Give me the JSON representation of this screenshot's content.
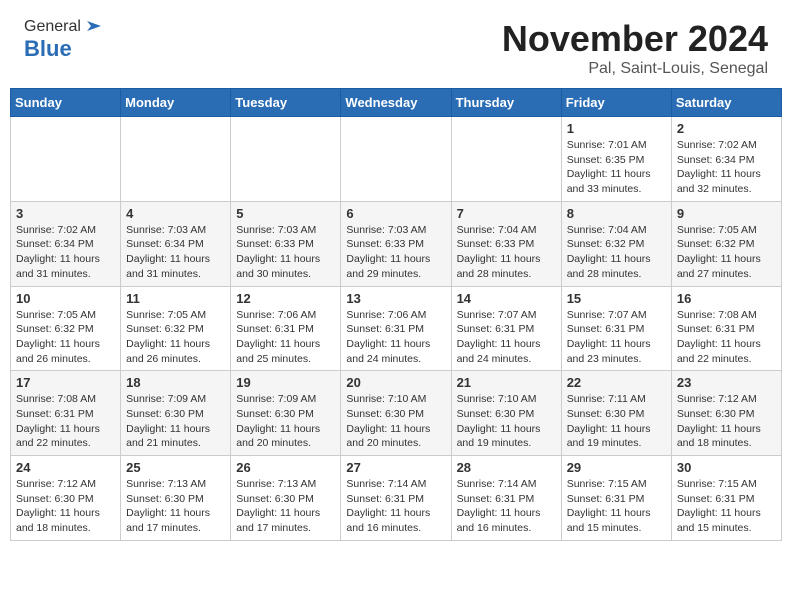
{
  "header": {
    "logo_general": "General",
    "logo_blue": "Blue",
    "month": "November 2024",
    "location": "Pal, Saint-Louis, Senegal"
  },
  "weekdays": [
    "Sunday",
    "Monday",
    "Tuesday",
    "Wednesday",
    "Thursday",
    "Friday",
    "Saturday"
  ],
  "weeks": [
    [
      {
        "day": "",
        "info": ""
      },
      {
        "day": "",
        "info": ""
      },
      {
        "day": "",
        "info": ""
      },
      {
        "day": "",
        "info": ""
      },
      {
        "day": "",
        "info": ""
      },
      {
        "day": "1",
        "info": "Sunrise: 7:01 AM\nSunset: 6:35 PM\nDaylight: 11 hours and 33 minutes."
      },
      {
        "day": "2",
        "info": "Sunrise: 7:02 AM\nSunset: 6:34 PM\nDaylight: 11 hours and 32 minutes."
      }
    ],
    [
      {
        "day": "3",
        "info": "Sunrise: 7:02 AM\nSunset: 6:34 PM\nDaylight: 11 hours and 31 minutes."
      },
      {
        "day": "4",
        "info": "Sunrise: 7:03 AM\nSunset: 6:34 PM\nDaylight: 11 hours and 31 minutes."
      },
      {
        "day": "5",
        "info": "Sunrise: 7:03 AM\nSunset: 6:33 PM\nDaylight: 11 hours and 30 minutes."
      },
      {
        "day": "6",
        "info": "Sunrise: 7:03 AM\nSunset: 6:33 PM\nDaylight: 11 hours and 29 minutes."
      },
      {
        "day": "7",
        "info": "Sunrise: 7:04 AM\nSunset: 6:33 PM\nDaylight: 11 hours and 28 minutes."
      },
      {
        "day": "8",
        "info": "Sunrise: 7:04 AM\nSunset: 6:32 PM\nDaylight: 11 hours and 28 minutes."
      },
      {
        "day": "9",
        "info": "Sunrise: 7:05 AM\nSunset: 6:32 PM\nDaylight: 11 hours and 27 minutes."
      }
    ],
    [
      {
        "day": "10",
        "info": "Sunrise: 7:05 AM\nSunset: 6:32 PM\nDaylight: 11 hours and 26 minutes."
      },
      {
        "day": "11",
        "info": "Sunrise: 7:05 AM\nSunset: 6:32 PM\nDaylight: 11 hours and 26 minutes."
      },
      {
        "day": "12",
        "info": "Sunrise: 7:06 AM\nSunset: 6:31 PM\nDaylight: 11 hours and 25 minutes."
      },
      {
        "day": "13",
        "info": "Sunrise: 7:06 AM\nSunset: 6:31 PM\nDaylight: 11 hours and 24 minutes."
      },
      {
        "day": "14",
        "info": "Sunrise: 7:07 AM\nSunset: 6:31 PM\nDaylight: 11 hours and 24 minutes."
      },
      {
        "day": "15",
        "info": "Sunrise: 7:07 AM\nSunset: 6:31 PM\nDaylight: 11 hours and 23 minutes."
      },
      {
        "day": "16",
        "info": "Sunrise: 7:08 AM\nSunset: 6:31 PM\nDaylight: 11 hours and 22 minutes."
      }
    ],
    [
      {
        "day": "17",
        "info": "Sunrise: 7:08 AM\nSunset: 6:31 PM\nDaylight: 11 hours and 22 minutes."
      },
      {
        "day": "18",
        "info": "Sunrise: 7:09 AM\nSunset: 6:30 PM\nDaylight: 11 hours and 21 minutes."
      },
      {
        "day": "19",
        "info": "Sunrise: 7:09 AM\nSunset: 6:30 PM\nDaylight: 11 hours and 20 minutes."
      },
      {
        "day": "20",
        "info": "Sunrise: 7:10 AM\nSunset: 6:30 PM\nDaylight: 11 hours and 20 minutes."
      },
      {
        "day": "21",
        "info": "Sunrise: 7:10 AM\nSunset: 6:30 PM\nDaylight: 11 hours and 19 minutes."
      },
      {
        "day": "22",
        "info": "Sunrise: 7:11 AM\nSunset: 6:30 PM\nDaylight: 11 hours and 19 minutes."
      },
      {
        "day": "23",
        "info": "Sunrise: 7:12 AM\nSunset: 6:30 PM\nDaylight: 11 hours and 18 minutes."
      }
    ],
    [
      {
        "day": "24",
        "info": "Sunrise: 7:12 AM\nSunset: 6:30 PM\nDaylight: 11 hours and 18 minutes."
      },
      {
        "day": "25",
        "info": "Sunrise: 7:13 AM\nSunset: 6:30 PM\nDaylight: 11 hours and 17 minutes."
      },
      {
        "day": "26",
        "info": "Sunrise: 7:13 AM\nSunset: 6:30 PM\nDaylight: 11 hours and 17 minutes."
      },
      {
        "day": "27",
        "info": "Sunrise: 7:14 AM\nSunset: 6:31 PM\nDaylight: 11 hours and 16 minutes."
      },
      {
        "day": "28",
        "info": "Sunrise: 7:14 AM\nSunset: 6:31 PM\nDaylight: 11 hours and 16 minutes."
      },
      {
        "day": "29",
        "info": "Sunrise: 7:15 AM\nSunset: 6:31 PM\nDaylight: 11 hours and 15 minutes."
      },
      {
        "day": "30",
        "info": "Sunrise: 7:15 AM\nSunset: 6:31 PM\nDaylight: 11 hours and 15 minutes."
      }
    ]
  ]
}
